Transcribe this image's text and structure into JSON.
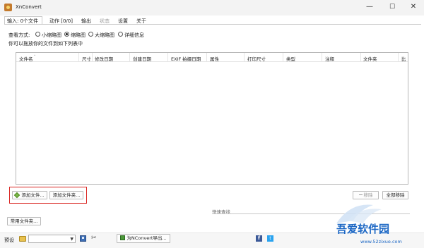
{
  "window": {
    "title": "XnConvert",
    "minimize": "—",
    "maximize": "☐",
    "close": "✕"
  },
  "tabs": [
    {
      "label": "输入: 0个文件",
      "state": "active"
    },
    {
      "label": "动作 [0/0]",
      "state": "normal"
    },
    {
      "label": "输出",
      "state": "normal"
    },
    {
      "label": "状态",
      "state": "disabled"
    },
    {
      "label": "设置",
      "state": "normal"
    },
    {
      "label": "关于",
      "state": "normal"
    }
  ],
  "view_mode": {
    "label": "查看方式:",
    "options": [
      "小缩略图",
      "缩略图",
      "大缩略图",
      "详细信息"
    ],
    "selected": "缩略图"
  },
  "hint": "你可以拖放你的文件到如下列表中",
  "list_columns": [
    "文件名",
    "尺寸",
    "修改日期",
    "创建日期",
    "EXIF 拍摄日期",
    "属性",
    "打印尺寸",
    "类型",
    "注释",
    "文件夹",
    "比"
  ],
  "buttons": {
    "add_files": "添加文件...",
    "add_folder": "添加文件夹...",
    "remove": "移除",
    "remove_all": "全部移除",
    "common_folders": "常用文件夹..."
  },
  "search": {
    "label": "快速查找"
  },
  "statusbar": {
    "preset_label": "预设",
    "preset_value": "",
    "export_label": "为NConvert导出..."
  },
  "watermark": {
    "text": "吾爱软件园",
    "url": "www.52zixue.com"
  },
  "colors": {
    "highlight_box": "#d9231f",
    "watermark": "#1c67c4"
  }
}
